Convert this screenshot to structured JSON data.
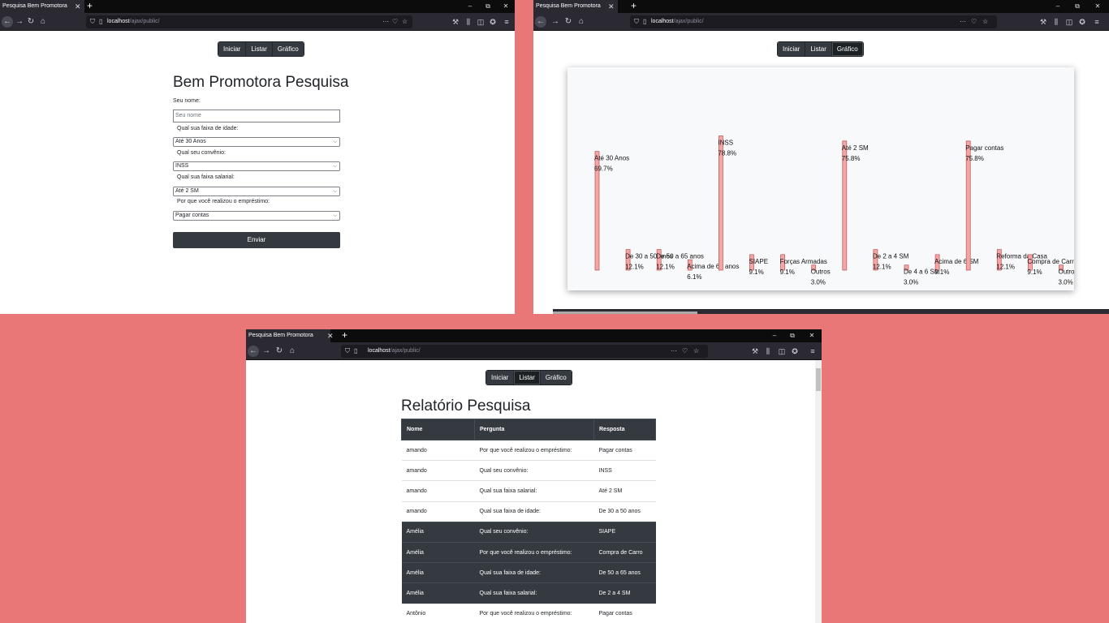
{
  "browser": {
    "tab_title": "Pesquisa Bem Promotora",
    "url_host": "localhost",
    "url_path": "/ajax/public/",
    "new_tab": "+",
    "tab_close": "✕",
    "min": "–",
    "restore": "⧉",
    "close": "✕",
    "icons": [
      "back-icon",
      "forward-icon",
      "reload-icon",
      "home-icon",
      "shield-icon",
      "page-icon",
      "more-icon",
      "pocket-icon",
      "star-icon",
      "wrench-icon",
      "library-icon",
      "sidebar-icon",
      "extension-icon",
      "menu-icon"
    ]
  },
  "nav": {
    "iniciar": "Iniciar",
    "listar": "Listar",
    "grafico": "Gráfico"
  },
  "form": {
    "title": "Bem Promotora Pesquisa",
    "name_label": "Seu nome:",
    "name_placeholder": "Seu nome",
    "age_label": "Qual sua faixa de idade:",
    "age_value": "Até 30 Anos",
    "agreement_label": "Qual seu convênio:",
    "agreement_value": "INSS",
    "salary_label": "Qual sua faixa salarial:",
    "salary_value": "Até 2 SM",
    "reason_label": "Por que você realizou o empréstimo:",
    "reason_value": "Pagar contas",
    "submit": "Enviar"
  },
  "chart_data": {
    "type": "bar",
    "bar_color": "#f4a6a6",
    "ylim": [
      0,
      100
    ],
    "title": "",
    "xlabel": "",
    "ylabel": "",
    "categories": [
      "Até 30 Anos",
      "De 30 a 50 anos",
      "De 50 a 65 anos",
      "Acima de 65 anos",
      "INSS",
      "SIAPE",
      "Forças Armadas",
      "Outros",
      "Até 2 SM",
      "De 2 a 4 SM",
      "De 4 a 6 SM",
      "Acima de 6 SM",
      "Pagar contas",
      "Reforma da Casa",
      "Compra de Carro",
      "Outros motivos"
    ],
    "values": [
      69.7,
      12.1,
      12.1,
      6.1,
      78.8,
      9.1,
      9.1,
      3.0,
      75.8,
      12.1,
      3.0,
      9.1,
      75.8,
      12.1,
      9.1,
      3.0
    ],
    "value_labels": [
      "69.7%",
      "12.1%",
      "12.1%",
      "6.1%",
      "78.8%",
      "9.1%",
      "9.1%",
      "3.0%",
      "75.8%",
      "12.1%",
      "3.0%",
      "9.1%",
      "75.8%",
      "12.1%",
      "9.1%",
      "3.0%"
    ]
  },
  "report": {
    "title": "Relatório Pesquisa",
    "headers": [
      "Nome",
      "Pergunta",
      "Resposta"
    ],
    "rows": [
      {
        "nome": "amando",
        "pergunta": "Por que você realizou o empréstimo:",
        "resposta": "Pagar contas",
        "dark": false
      },
      {
        "nome": "amando",
        "pergunta": "Qual seu convênio:",
        "resposta": "INSS",
        "dark": false
      },
      {
        "nome": "amando",
        "pergunta": "Qual sua faixa salarial:",
        "resposta": "Até 2 SM",
        "dark": false
      },
      {
        "nome": "amando",
        "pergunta": "Qual sua faixa de idade:",
        "resposta": "De 30 a 50 anos",
        "dark": false
      },
      {
        "nome": "Amélia",
        "pergunta": "Qual seu convênio:",
        "resposta": "SIAPE",
        "dark": true
      },
      {
        "nome": "Amélia",
        "pergunta": "Por que você realizou o empréstimo:",
        "resposta": "Compra de Carro",
        "dark": true
      },
      {
        "nome": "Amélia",
        "pergunta": "Qual sua faixa de idade:",
        "resposta": "De 50 a 65 anos",
        "dark": true
      },
      {
        "nome": "Amélia",
        "pergunta": "Qual sua faixa salarial:",
        "resposta": "De 2 a 4 SM",
        "dark": true
      },
      {
        "nome": "Antônio",
        "pergunta": "Por que você realizou o empréstimo:",
        "resposta": "Pagar contas",
        "dark": false
      }
    ]
  }
}
